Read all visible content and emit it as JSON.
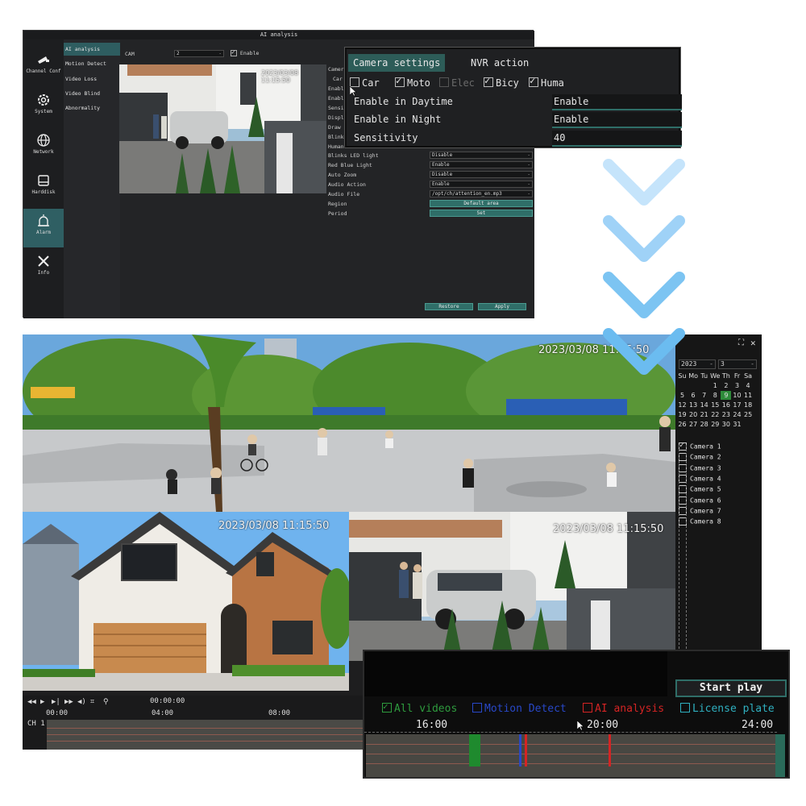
{
  "config_window": {
    "title": "AI analysis",
    "nav": [
      {
        "label": "Channel Conf",
        "icon": "camera-icon"
      },
      {
        "label": "System",
        "icon": "gear-icon"
      },
      {
        "label": "Network",
        "icon": "globe-icon"
      },
      {
        "label": "Harddisk",
        "icon": "harddisk-icon"
      },
      {
        "label": "Alarm",
        "icon": "alarm-icon",
        "active": true
      },
      {
        "label": "Info",
        "icon": "tools-icon"
      }
    ],
    "menu": [
      "AI analysis",
      "Motion Detect",
      "Video Loss",
      "Video Blind",
      "Abnormality"
    ],
    "cam_label": "CAM",
    "cam_value": "2",
    "enable_label": "Enable",
    "preview_timestamp": "2023/03/08 11:15:50",
    "rows_partial": [
      "Camer",
      "Car",
      "Enabl",
      "Enabl",
      "Sensi",
      "Displ",
      "Draw",
      "Blink",
      "Human"
    ],
    "rows": [
      {
        "label": "Blinks LED light",
        "value": "Disable"
      },
      {
        "label": "Red Blue Light",
        "value": "Enable"
      },
      {
        "label": "Auto Zoom",
        "value": "Disable"
      },
      {
        "label": "Audio Action",
        "value": "Enable"
      },
      {
        "label": "Audio File",
        "value": "/opt/ch/attention_en.mp3"
      }
    ],
    "region_label": "Region",
    "region_button": "Default area",
    "period_label": "Period",
    "period_button": "Set",
    "restore_button": "Restore",
    "apply_button": "Apply"
  },
  "camera_settings_popup": {
    "tab_active": "Camera settings",
    "tab_other": "NVR action",
    "targets": [
      {
        "label": "Car",
        "checked": false
      },
      {
        "label": "Moto",
        "checked": true
      },
      {
        "label": "Elec",
        "checked": false,
        "disabled": true
      },
      {
        "label": "Bicy",
        "checked": true
      },
      {
        "label": "Huma",
        "checked": true
      }
    ],
    "settings": [
      {
        "label": "Enable in Daytime",
        "value": "Enable"
      },
      {
        "label": "Enable in Night",
        "value": "Enable"
      },
      {
        "label": "Sensitivity",
        "value": "40"
      }
    ]
  },
  "viewer": {
    "timestamps": [
      "2023/03/08 11:15:50",
      "2023/03/08 11:15:50",
      "2023/03/08 11:15:50"
    ],
    "calendar": {
      "year": "2023",
      "month": "3",
      "weekdays": [
        "Su",
        "Mo",
        "Tu",
        "We",
        "Th",
        "Fr",
        "Sa"
      ],
      "weeks": [
        [
          "",
          "",
          "",
          "1",
          "2",
          "3",
          "4"
        ],
        [
          "5",
          "6",
          "7",
          "8",
          "9",
          "10",
          "11"
        ],
        [
          "12",
          "13",
          "14",
          "15",
          "16",
          "17",
          "18"
        ],
        [
          "19",
          "20",
          "21",
          "22",
          "23",
          "24",
          "25"
        ],
        [
          "26",
          "27",
          "28",
          "29",
          "30",
          "31",
          ""
        ]
      ],
      "selected_day": "9"
    },
    "cameras": [
      {
        "label": "Camera 1",
        "checked": true
      },
      {
        "label": "Camera 2",
        "checked": false
      },
      {
        "label": "Camera 3",
        "checked": false
      },
      {
        "label": "Camera 4",
        "checked": false
      },
      {
        "label": "Camera 5",
        "checked": false
      },
      {
        "label": "Camera 6",
        "checked": false
      },
      {
        "label": "Camera 7",
        "checked": false
      },
      {
        "label": "Camera 8",
        "checked": false
      }
    ],
    "playback_time": "00:00:00",
    "timeline_ticks": [
      "00:00",
      "04:00",
      "08:00"
    ],
    "channel_label": "CH 1"
  },
  "timeline_popup": {
    "start_play": "Start play",
    "legend": [
      {
        "label": "All videos",
        "color": "#2e9b3e",
        "checked": true
      },
      {
        "label": "Motion Detect",
        "color": "#2848c8",
        "checked": false
      },
      {
        "label": "AI analysis",
        "color": "#d42424",
        "checked": false
      },
      {
        "label": "License plate",
        "color": "#2fb0c0",
        "checked": false
      }
    ],
    "ticks": [
      "16:00",
      "20:00",
      "24:00"
    ]
  },
  "colors": {
    "accent": "#2f6e68",
    "chevron": "#7cc4f2"
  }
}
